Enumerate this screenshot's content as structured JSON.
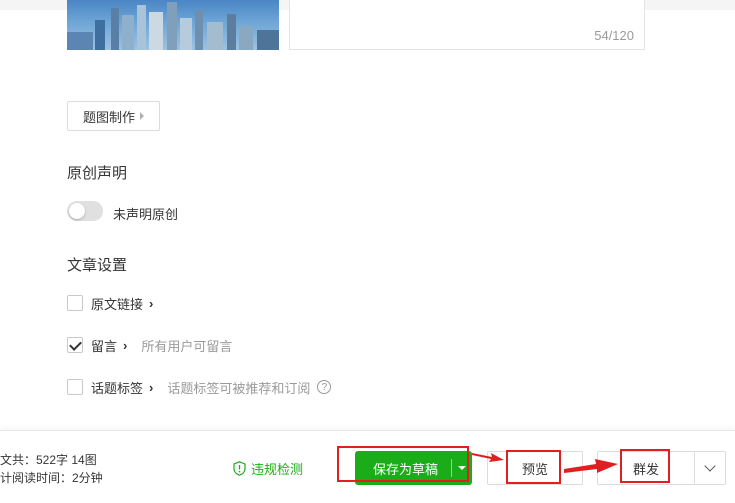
{
  "summary": {
    "counter": "54/120"
  },
  "cover": {
    "make_button": "题图制作"
  },
  "original": {
    "title": "原创声明",
    "toggle_label": "未声明原创"
  },
  "article_settings": {
    "title": "文章设置",
    "rows": [
      {
        "label": "原文链接",
        "hint": "",
        "checked": false
      },
      {
        "label": "留言",
        "hint": "所有用户可留言",
        "checked": true
      },
      {
        "label": "话题标签",
        "hint": "话题标签可被推荐和订阅",
        "checked": false
      }
    ],
    "help_icon": "?"
  },
  "footer": {
    "stats_line1": "文共：522字 14图",
    "stats_line2": "计阅读时间：2分钟",
    "violation_check": "违规检测",
    "save_draft": "保存为草稿",
    "preview": "预览",
    "mass_send": "群发"
  },
  "colors": {
    "accent_green": "#1aad19",
    "annotation_red": "#e02020"
  }
}
